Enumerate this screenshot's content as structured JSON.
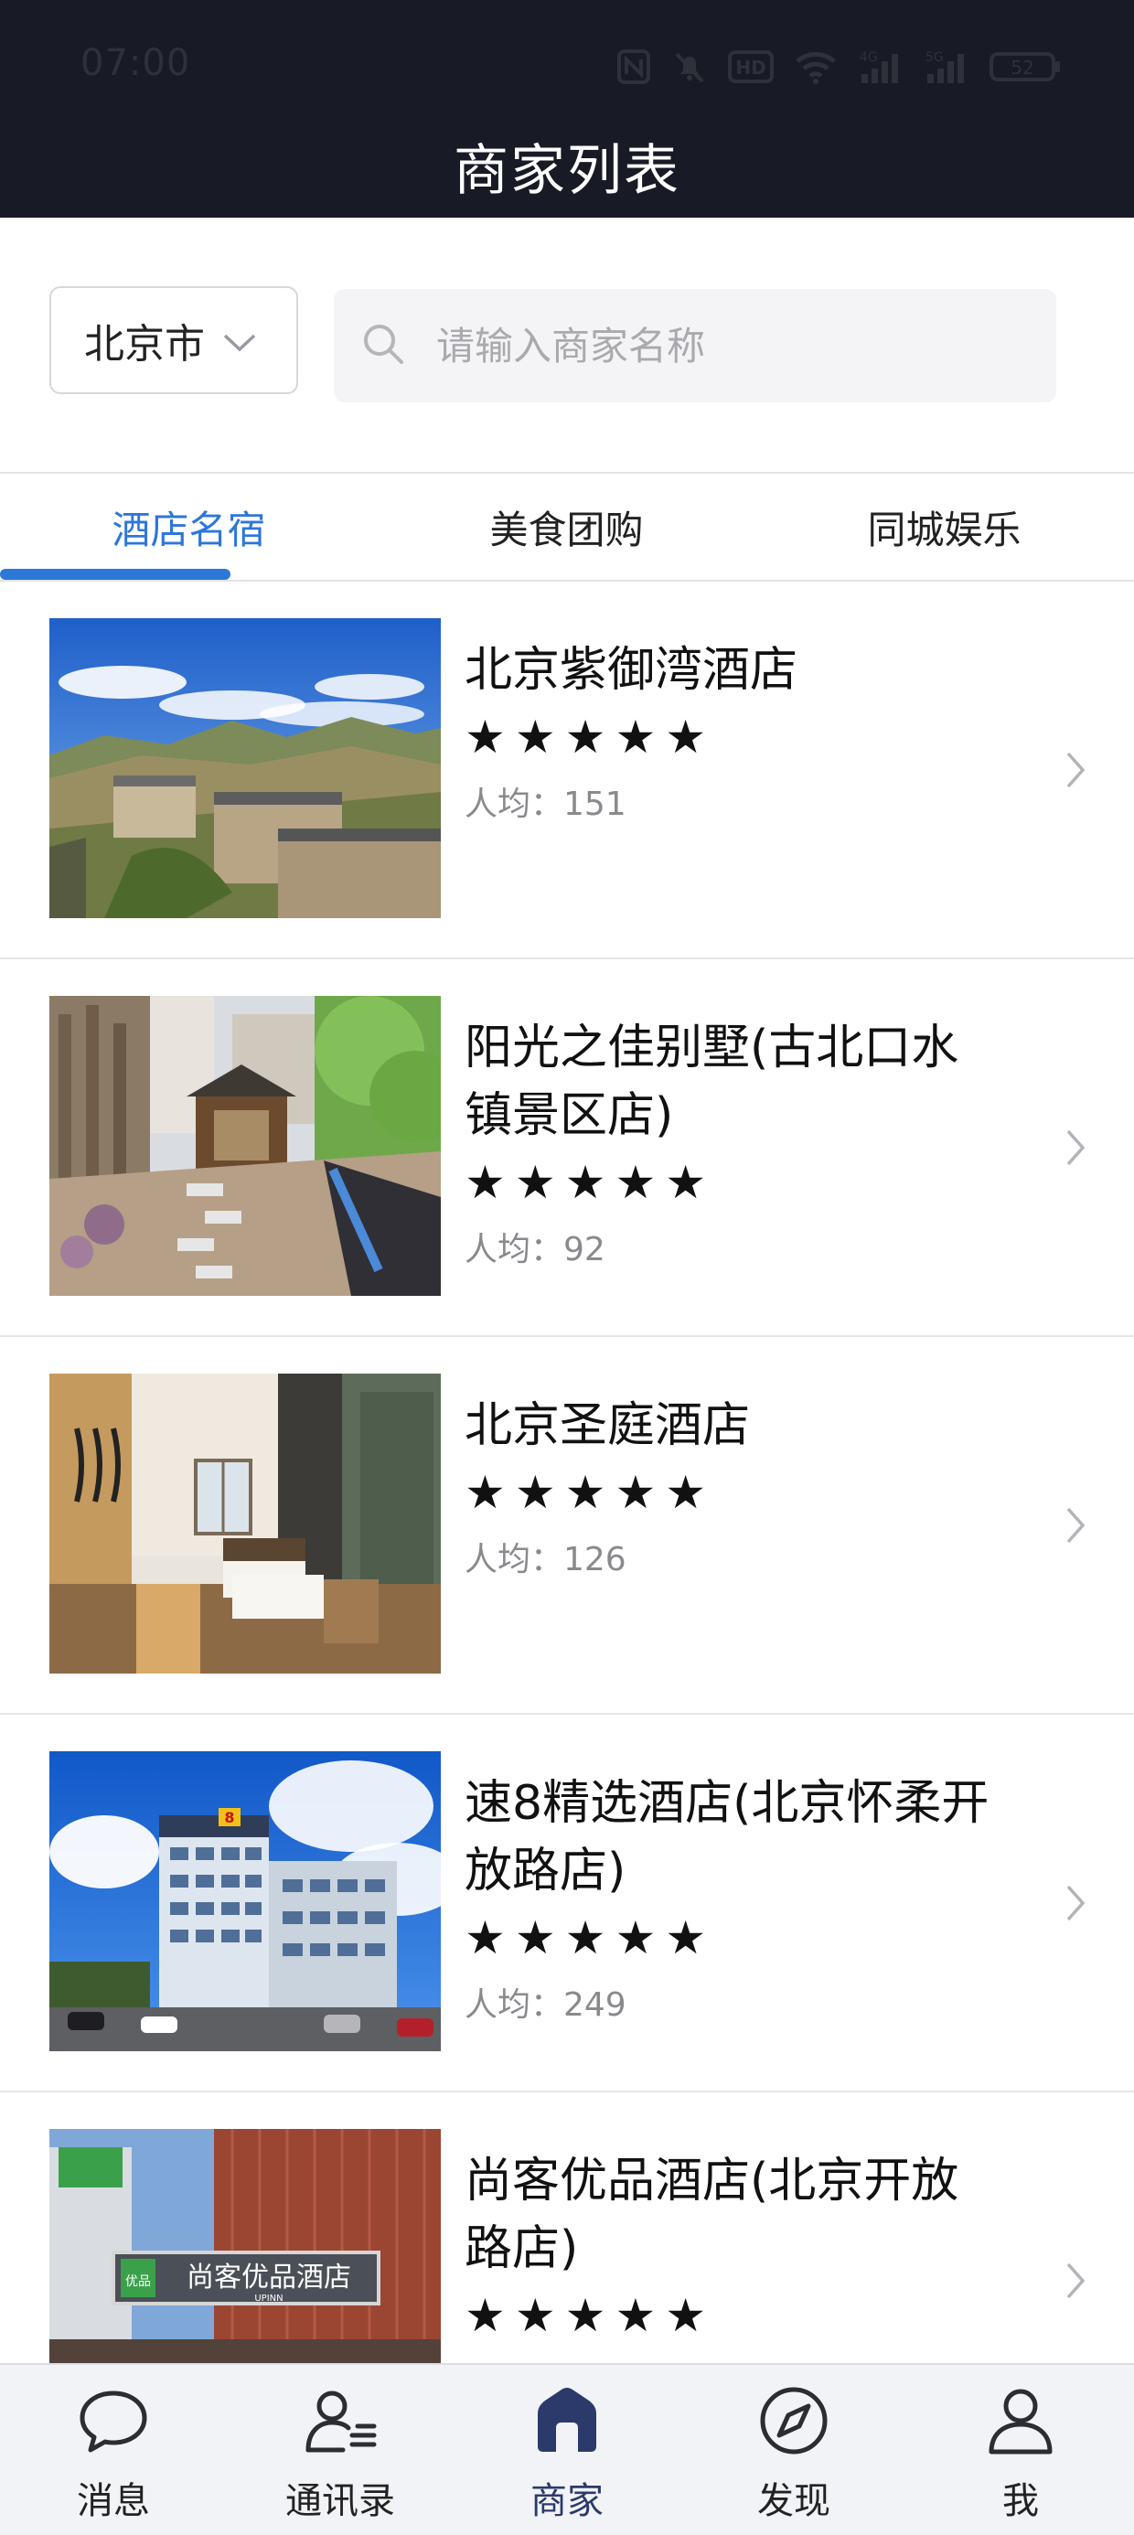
{
  "status_bar": {
    "time": "07:00",
    "battery": "52",
    "network_labels": [
      "4G",
      "5G"
    ],
    "hd_label": "HD"
  },
  "header": {
    "title": "商家列表"
  },
  "filter": {
    "city": "北京市",
    "search_placeholder": "请输入商家名称",
    "search_value": ""
  },
  "tabs": [
    {
      "label": "酒店名宿",
      "active": true
    },
    {
      "label": "美食团购",
      "active": false
    },
    {
      "label": "同城娱乐",
      "active": false
    }
  ],
  "merchants": [
    {
      "name": "北京紫御湾酒店",
      "stars": "★★★★★",
      "rating": 5,
      "price_label": "人均：151"
    },
    {
      "name": "阳光之佳别墅(古北口水镇景区店)",
      "stars": "★★★★★",
      "rating": 5,
      "price_label": "人均：92"
    },
    {
      "name": "北京圣庭酒店",
      "stars": "★★★★★",
      "rating": 5,
      "price_label": "人均：126"
    },
    {
      "name": "速8精选酒店(北京怀柔开放路店)",
      "stars": "★★★★★",
      "rating": 5,
      "price_label": "人均：249"
    },
    {
      "name": "尚客优品酒店(北京开放路店)",
      "stars": "★★★★★",
      "rating": 5,
      "price_label": ""
    }
  ],
  "image_text": {
    "hotel_sign": "尚客优品酒店",
    "hotel_sign_en": "UPINN",
    "logo_mark": "优品",
    "super8_mark": "8"
  },
  "bottom_nav": [
    {
      "label": "消息",
      "icon": "chat-bubble-icon",
      "active": false
    },
    {
      "label": "通讯录",
      "icon": "contacts-icon",
      "active": false
    },
    {
      "label": "商家",
      "icon": "store-icon",
      "active": true
    },
    {
      "label": "发现",
      "icon": "compass-icon",
      "active": false
    },
    {
      "label": "我",
      "icon": "user-icon",
      "active": false
    }
  ],
  "colors": {
    "header_bg": "#181a25",
    "accent": "#2d77d8",
    "nav_active": "#2b3a6b",
    "nav_bg": "#f2f3f6"
  }
}
